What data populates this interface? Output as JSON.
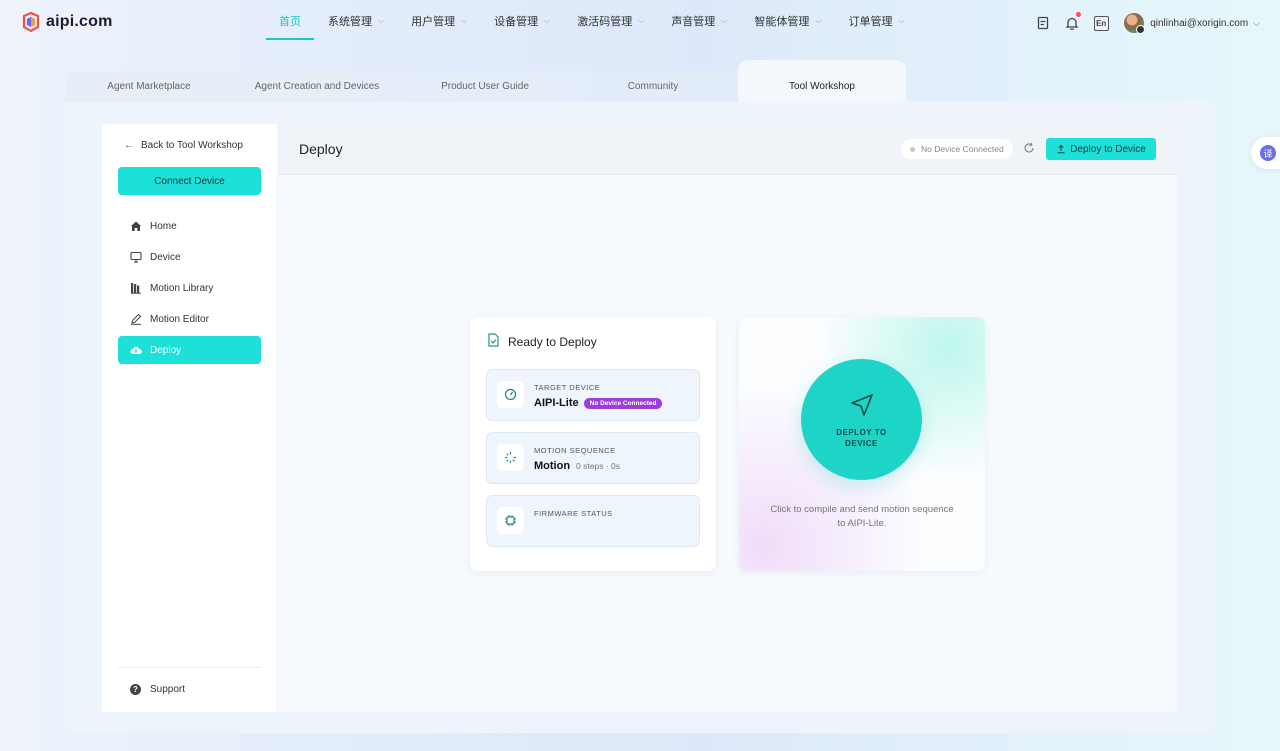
{
  "brand": {
    "logo_text": "aipi.com"
  },
  "nav": {
    "items": [
      {
        "label": "首页",
        "has_menu": false,
        "active": true
      },
      {
        "label": "系统管理",
        "has_menu": true
      },
      {
        "label": "用户管理",
        "has_menu": true
      },
      {
        "label": "设备管理",
        "has_menu": true
      },
      {
        "label": "激活码管理",
        "has_menu": true
      },
      {
        "label": "声音管理",
        "has_menu": true
      },
      {
        "label": "智能体管理",
        "has_menu": true
      },
      {
        "label": "订单管理",
        "has_menu": true
      }
    ],
    "chevron": "⌵"
  },
  "header": {
    "lang_label": "En",
    "user_email": "qinlinhai@xorigin.com",
    "icons": [
      "document-icon",
      "bell-icon",
      "language-icon",
      "avatar"
    ]
  },
  "tabs": [
    {
      "label": "Agent Marketplace"
    },
    {
      "label": "Agent Creation and Devices"
    },
    {
      "label": "Product User Guide"
    },
    {
      "label": "Community"
    },
    {
      "label": "Tool Workshop",
      "active": true
    }
  ],
  "sidebar": {
    "back_label": "Back to Tool Workshop",
    "connect_label": "Connect Device",
    "items": [
      {
        "label": "Home",
        "icon": "home-icon"
      },
      {
        "label": "Device",
        "icon": "monitor-icon"
      },
      {
        "label": "Motion Library",
        "icon": "library-icon"
      },
      {
        "label": "Motion Editor",
        "icon": "edit-icon"
      },
      {
        "label": "Deploy",
        "icon": "cloud-upload-icon",
        "active": true
      }
    ],
    "support_label": "Support"
  },
  "content": {
    "title": "Deploy",
    "status_text": "No Device Connected",
    "deploy_button_label": "Deploy to Device",
    "ready_card": {
      "title": "Ready to Deploy",
      "target": {
        "label": "TARGET DEVICE",
        "value": "AIPI-Lite",
        "badge": "No Device Connected"
      },
      "motion": {
        "label": "MOTION SEQUENCE",
        "value": "Motion",
        "sub": "0 steps · 0s"
      },
      "firmware": {
        "label": "FIRMWARE STATUS"
      }
    },
    "deploy_card": {
      "button_line1": "DEPLOY TO",
      "button_line2": "DEVICE",
      "hint": "Click to compile and send motion sequence to AIPI-Lite."
    }
  },
  "colors": {
    "accent": "#1de0d8",
    "nav_active": "#17c7c2",
    "badge": "#9b3ee0"
  }
}
